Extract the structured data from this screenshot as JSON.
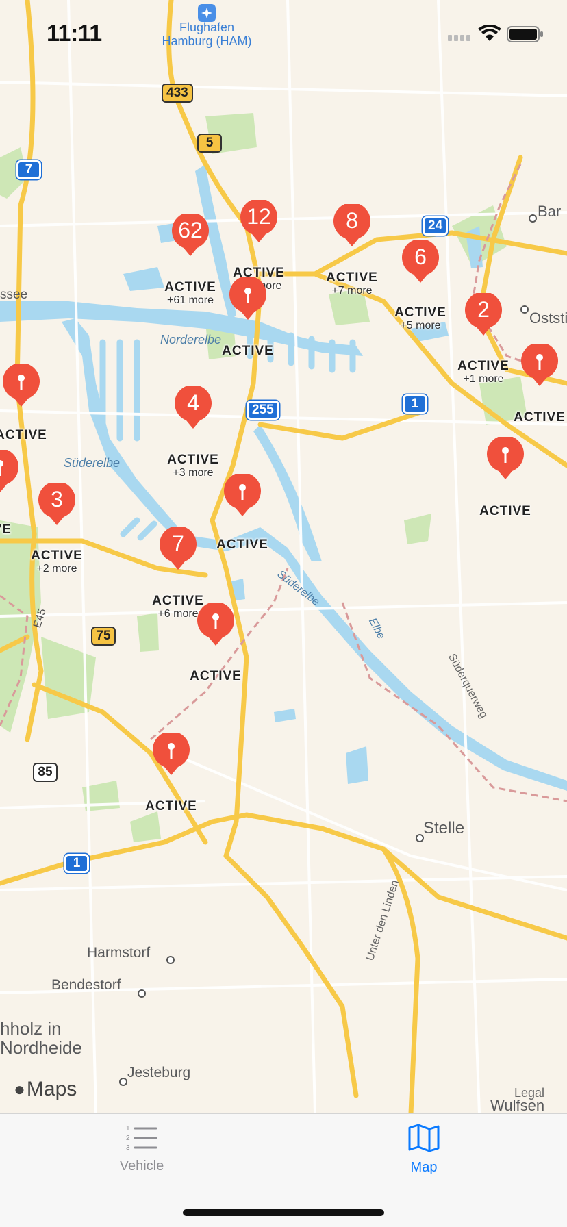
{
  "status_bar": {
    "time": "11:11"
  },
  "map": {
    "place_labels": {
      "airport": "Flughafen\nHamburg (HAM)",
      "bar": "Bar",
      "ossee": "ssee",
      "oststeinbek": "Oststi",
      "norderelbe": "Norderelbe",
      "suederelbe_west": "Süderelbe",
      "suederelbe_river": "Süderelbe",
      "elbe": "Elbe",
      "suederquerweg": "Süderquerweg",
      "stelle": "Stelle",
      "unter_den_linden": "Unter den Linden",
      "harmstorf": "Harmstorf",
      "bendestorf": "Bendestorf",
      "buchholz": "hholz in\nNordheide",
      "jesteburg": "Jesteburg",
      "wulfsen": "Wulfsen",
      "e45": "E45"
    },
    "road_badges": {
      "r433": "433",
      "r5": "5",
      "r7": "7",
      "r24": "24",
      "r255": "255",
      "r1_east": "1",
      "r75": "75",
      "r85": "85",
      "r1_south": "1"
    },
    "attribution": "Maps",
    "legal": "Legal",
    "markers": [
      {
        "count": "62",
        "status": "ACTIVE",
        "more": "+61 more"
      },
      {
        "count": "12",
        "status": "ACTIVE",
        "more": "+11 more"
      },
      {
        "count": "8",
        "status": "ACTIVE",
        "more": "+7 more"
      },
      {
        "count": "6",
        "status": "ACTIVE",
        "more": "+5 more"
      },
      {
        "count": "2",
        "status": "ACTIVE",
        "more": "+1 more"
      },
      {
        "count": "",
        "status": "ACTIVE",
        "more": ""
      },
      {
        "count": "",
        "status": "ACTIVE",
        "more": ""
      },
      {
        "count": "",
        "status": "ACTIVE",
        "more": ""
      },
      {
        "count": "4",
        "status": "ACTIVE",
        "more": "+3 more"
      },
      {
        "count": "",
        "status": "ACTIVE",
        "more": ""
      },
      {
        "count": "",
        "status": "ACTIVE",
        "more": ""
      },
      {
        "count": "3",
        "status": "ACTIVE",
        "more": "+2 more"
      },
      {
        "count": "",
        "status": "IVE",
        "more": ""
      },
      {
        "count": "7",
        "status": "ACTIVE",
        "more": "+6 more"
      },
      {
        "count": "",
        "status": "ACTIVE",
        "more": ""
      },
      {
        "count": "",
        "status": "ACTIVE",
        "more": ""
      }
    ]
  },
  "tab_bar": {
    "tabs": [
      {
        "label": "Vehicle",
        "icon": "numbered-list-icon",
        "selected": false
      },
      {
        "label": "Map",
        "icon": "map-icon",
        "selected": true
      }
    ],
    "active_color": "#0a7aff",
    "inactive_color": "#8e8e93"
  },
  "colors": {
    "pin": "#f0503c",
    "water": "#a9d8f0",
    "park": "#c9e6b0",
    "highway": "#f7c948"
  }
}
